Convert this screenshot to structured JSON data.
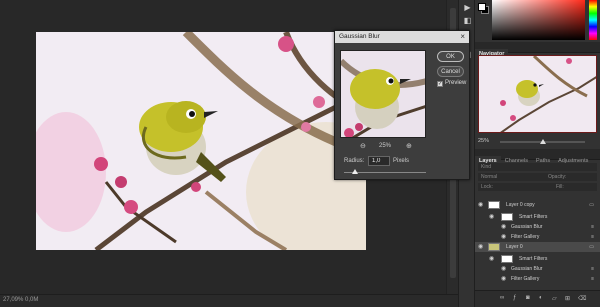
{
  "status": {
    "zoom_text": "27,09% 0,0M"
  },
  "dialog": {
    "title": "Gaussian Blur",
    "ok_label": "OK",
    "cancel_label": "Cancel",
    "preview_label": "Preview",
    "preview_checked": true,
    "zoom_out_icon": "zoom-out-icon",
    "zoom_in_icon": "zoom-in-icon",
    "zoom_value": "25%",
    "radius_label": "Radius:",
    "radius_value": "1,0",
    "radius_unit": "Pixels"
  },
  "navigator": {
    "tab_label": "Navigator",
    "zoom": "25%"
  },
  "layers_panel": {
    "tabs": [
      "Layers",
      "Channels",
      "Paths",
      "Adjustments"
    ],
    "search_placeholder": "Kind",
    "mode": "Normal",
    "opacity_label": "Opacity:",
    "lock_label": "Lock:",
    "fill_label": "Fill:",
    "rows": [
      {
        "label": "Layer 0 copy",
        "type": "layer"
      },
      {
        "label": "Smart Filters",
        "type": "smart-filters"
      },
      {
        "label": "Gaussian Blur",
        "type": "filter"
      },
      {
        "label": "Filter Gallery",
        "type": "filter"
      },
      {
        "label": "Layer 0",
        "type": "layer"
      },
      {
        "label": "Smart Filters",
        "type": "smart-filters"
      },
      {
        "label": "Gaussian Blur",
        "type": "filter"
      },
      {
        "label": "Filter Gallery",
        "type": "filter"
      }
    ]
  },
  "colors": {
    "app_bg": "#282828",
    "panel_bg": "#323232",
    "navigator_frame": "#6c1a1a",
    "bird_yellow": "#c5c12a",
    "blossom_pink": "#d2457a"
  }
}
